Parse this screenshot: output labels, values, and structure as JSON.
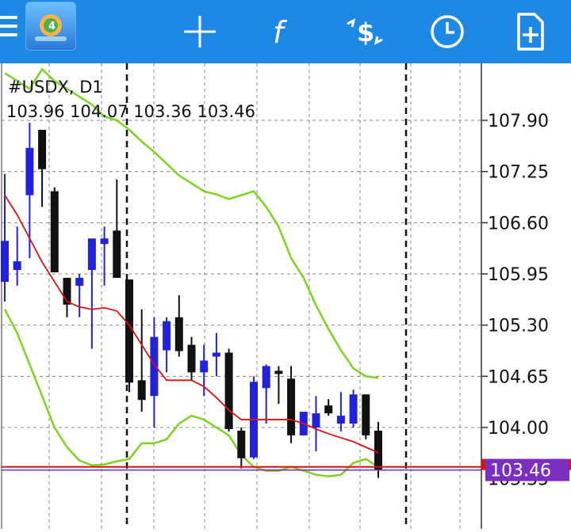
{
  "toolbar": {
    "items": [
      {
        "name": "menu-icon"
      },
      {
        "name": "metatrader-logo-icon"
      },
      {
        "name": "crosshair-icon"
      },
      {
        "name": "indicators-f-icon"
      },
      {
        "name": "trade-dollar-icon"
      },
      {
        "name": "period-clock-icon"
      },
      {
        "name": "add-object-icon"
      }
    ],
    "colors": {
      "background": "#1E88E5",
      "icon": "#ffffff"
    }
  },
  "chart_data": {
    "type": "candlestick",
    "title": "#USDX, D1",
    "ohlc_label": "103.96 104.07 103.36 103.46",
    "y_ticks": [
      "107.90",
      "107.25",
      "106.60",
      "105.95",
      "105.30",
      "104.65",
      "104.00"
    ],
    "ylim": [
      103.0,
      108.3
    ],
    "grid": true,
    "bid_label": "103.46",
    "ask_label_partial": "103.50",
    "lower_tick_partial": "103.35",
    "bid_price": 103.46,
    "ask_price": 103.5,
    "colors": {
      "bull": "#2222DD",
      "bear": "#111111",
      "ma": "#DD1111",
      "bands": "#7ED321",
      "bid_line": "#7B2FBE",
      "ask_line": "#DD1111",
      "grid": "#999999"
    },
    "candles": [
      {
        "o": 105.85,
        "h": 107.22,
        "l": 105.6,
        "c": 106.37,
        "dir": "bull"
      },
      {
        "o": 106.0,
        "h": 106.55,
        "l": 105.8,
        "c": 106.11,
        "dir": "bull"
      },
      {
        "o": 106.95,
        "h": 107.87,
        "l": 106.15,
        "c": 107.55,
        "dir": "bull"
      },
      {
        "o": 107.78,
        "h": 107.78,
        "l": 106.8,
        "c": 107.28,
        "dir": "bear"
      },
      {
        "o": 107.0,
        "h": 107.05,
        "l": 105.97,
        "c": 105.97,
        "dir": "bear"
      },
      {
        "o": 105.9,
        "h": 105.9,
        "l": 105.4,
        "c": 105.56,
        "dir": "bear"
      },
      {
        "o": 105.8,
        "h": 105.95,
        "l": 105.4,
        "c": 105.9,
        "dir": "bull"
      },
      {
        "o": 106.0,
        "h": 106.35,
        "l": 105.0,
        "c": 106.4,
        "dir": "bull"
      },
      {
        "o": 106.33,
        "h": 106.55,
        "l": 105.8,
        "c": 106.4,
        "dir": "bull"
      },
      {
        "o": 106.5,
        "h": 107.15,
        "l": 105.9,
        "c": 105.9,
        "dir": "bear"
      },
      {
        "o": 105.88,
        "h": 105.88,
        "l": 104.45,
        "c": 104.57,
        "dir": "bear"
      },
      {
        "o": 104.6,
        "h": 105.5,
        "l": 104.2,
        "c": 104.35,
        "dir": "bear"
      },
      {
        "o": 104.4,
        "h": 105.4,
        "l": 104.0,
        "c": 105.15,
        "dir": "bull"
      },
      {
        "o": 104.98,
        "h": 105.4,
        "l": 104.7,
        "c": 105.35,
        "dir": "bull"
      },
      {
        "o": 105.4,
        "h": 105.68,
        "l": 104.9,
        "c": 104.97,
        "dir": "bear"
      },
      {
        "o": 105.05,
        "h": 105.15,
        "l": 104.6,
        "c": 104.7,
        "dir": "bear"
      },
      {
        "o": 104.7,
        "h": 105.05,
        "l": 104.4,
        "c": 104.85,
        "dir": "bull"
      },
      {
        "o": 104.9,
        "h": 105.2,
        "l": 104.65,
        "c": 104.95,
        "dir": "bull"
      },
      {
        "o": 104.95,
        "h": 105.0,
        "l": 103.95,
        "c": 103.98,
        "dir": "bear"
      },
      {
        "o": 103.96,
        "h": 104.0,
        "l": 103.48,
        "c": 103.61,
        "dir": "bear"
      },
      {
        "o": 103.62,
        "h": 104.65,
        "l": 103.6,
        "c": 104.58,
        "dir": "bull"
      },
      {
        "o": 104.5,
        "h": 104.8,
        "l": 104.05,
        "c": 104.78,
        "dir": "bull"
      },
      {
        "o": 104.72,
        "h": 104.78,
        "l": 104.3,
        "c": 104.68,
        "dir": "bear"
      },
      {
        "o": 104.62,
        "h": 104.78,
        "l": 103.8,
        "c": 103.9,
        "dir": "bear"
      },
      {
        "o": 103.9,
        "h": 104.1,
        "l": 103.95,
        "c": 104.2,
        "dir": "bull"
      },
      {
        "o": 104.0,
        "h": 104.4,
        "l": 103.7,
        "c": 104.18,
        "dir": "bull"
      },
      {
        "o": 104.28,
        "h": 104.36,
        "l": 104.15,
        "c": 104.18,
        "dir": "bear"
      },
      {
        "o": 104.05,
        "h": 104.45,
        "l": 103.95,
        "c": 104.15,
        "dir": "bull"
      },
      {
        "o": 104.05,
        "h": 104.48,
        "l": 104.0,
        "c": 104.42,
        "dir": "bull"
      },
      {
        "o": 104.42,
        "h": 104.42,
        "l": 103.85,
        "c": 103.9,
        "dir": "bear"
      },
      {
        "o": 103.96,
        "h": 104.07,
        "l": 103.36,
        "c": 103.46,
        "dir": "bear"
      }
    ],
    "ma": [
      106.95,
      106.7,
      106.4,
      106.1,
      105.85,
      105.6,
      105.53,
      105.5,
      105.52,
      105.48,
      105.3,
      105.05,
      104.8,
      104.6,
      104.6,
      104.6,
      104.52,
      104.38,
      104.22,
      104.1,
      104.1,
      104.1,
      104.1,
      104.1,
      104.05,
      103.98,
      103.92,
      103.87,
      103.82,
      103.75,
      103.68
    ],
    "upper_band": [
      108.5,
      108.4,
      108.3,
      108.55,
      108.4,
      108.3,
      108.2,
      108.1,
      107.95,
      107.9,
      107.78,
      107.63,
      107.5,
      107.35,
      107.2,
      107.1,
      107.0,
      106.96,
      106.9,
      106.95,
      107.0,
      106.8,
      106.55,
      106.15,
      105.9,
      105.55,
      105.25,
      104.98,
      104.75,
      104.65,
      104.63
    ],
    "lower_band": [
      105.5,
      105.2,
      104.8,
      104.4,
      104.0,
      103.75,
      103.58,
      103.52,
      103.53,
      103.57,
      103.6,
      103.8,
      103.8,
      103.85,
      104.05,
      104.15,
      104.1,
      104.0,
      103.9,
      103.65,
      103.5,
      103.45,
      103.45,
      103.5,
      103.45,
      103.4,
      103.38,
      103.4,
      103.55,
      103.6,
      103.5
    ]
  }
}
